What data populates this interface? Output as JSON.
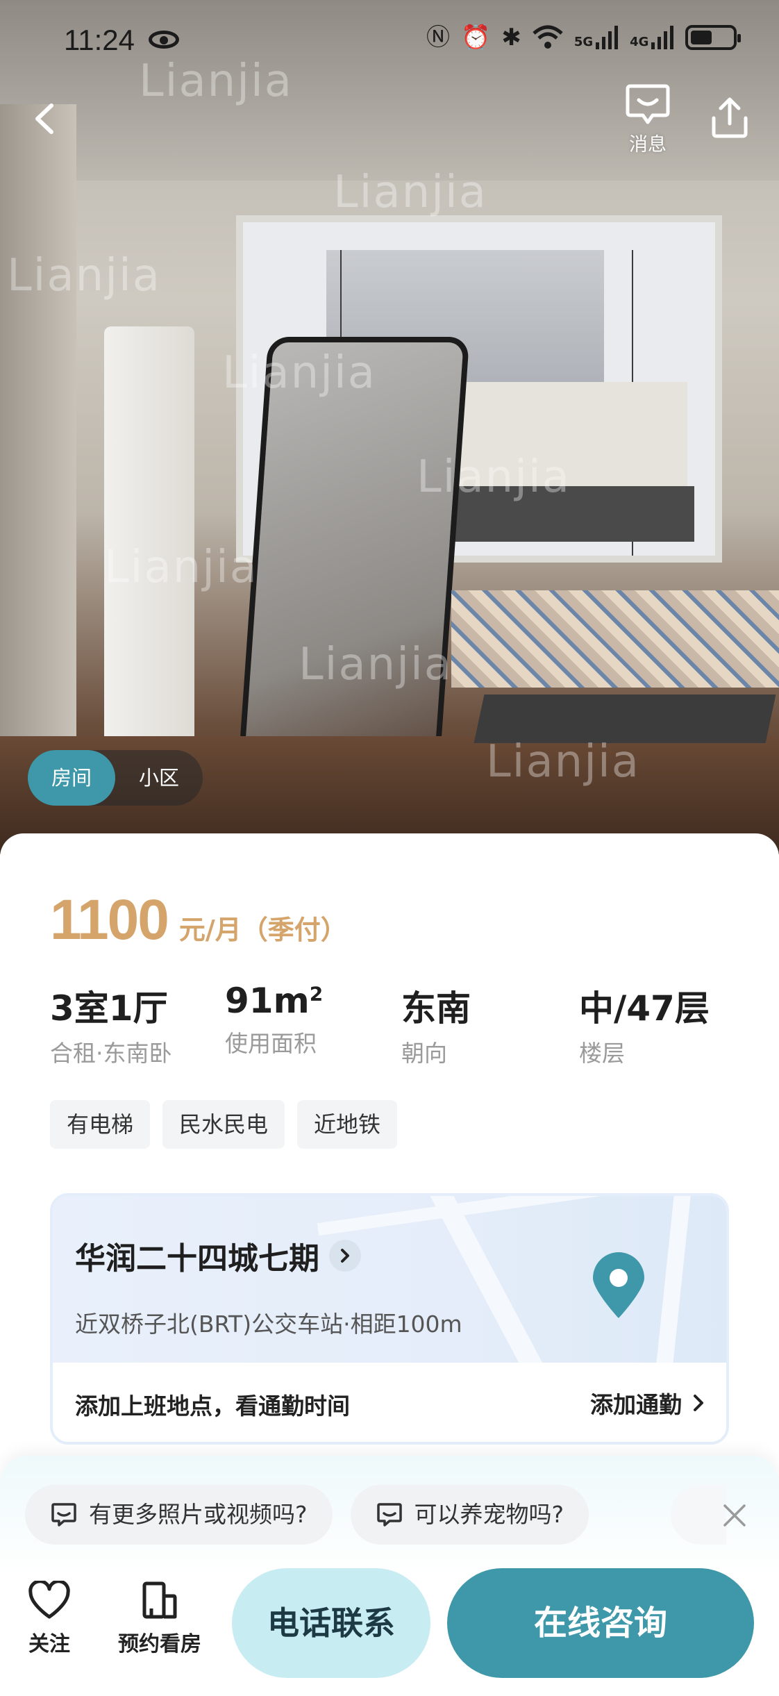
{
  "status_bar": {
    "time": "11:24",
    "icons": [
      "eye-icon",
      "nfc-icon",
      "alarm-icon",
      "bluetooth-icon",
      "wifi-icon",
      "5g-signal-icon",
      "4g-signal-icon",
      "battery-icon"
    ],
    "net1": "5G",
    "net2": "4G"
  },
  "header": {
    "back_icon": "chevron-left-icon",
    "message_label": "消息",
    "share_icon": "share-icon"
  },
  "hero": {
    "watermark": "Lianjia",
    "tabs": [
      {
        "label": "房间",
        "active": true
      },
      {
        "label": "小区",
        "active": false
      }
    ]
  },
  "listing": {
    "price": "1100",
    "price_unit": "元/月（季付）",
    "specs": [
      {
        "value": "3室1厅",
        "label": "合租·东南卧"
      },
      {
        "value": "91m",
        "sup": "2",
        "label": "使用面积"
      },
      {
        "value": "东南",
        "label": "朝向"
      },
      {
        "value": "中/47层",
        "label": "楼层"
      }
    ],
    "tags": [
      "有电梯",
      "民水民电",
      "近地铁"
    ]
  },
  "location": {
    "community": "华润二十四城七期",
    "nearby": "近双桥子北(BRT)公交车站·相距100m",
    "commute_prompt": "添加上班地点，看通勤时间",
    "commute_button": "添加通勤"
  },
  "quick_questions": [
    "有更多照片或视频吗?",
    "可以养宠物吗?"
  ],
  "actions": {
    "follow_label": "关注",
    "book_label": "预约看房",
    "call_label": "电话联系",
    "consult_label": "在线咨询"
  },
  "colors": {
    "accent": "#3e98a9",
    "price": "#d4a46a",
    "call_bg": "#c7ecf2"
  }
}
